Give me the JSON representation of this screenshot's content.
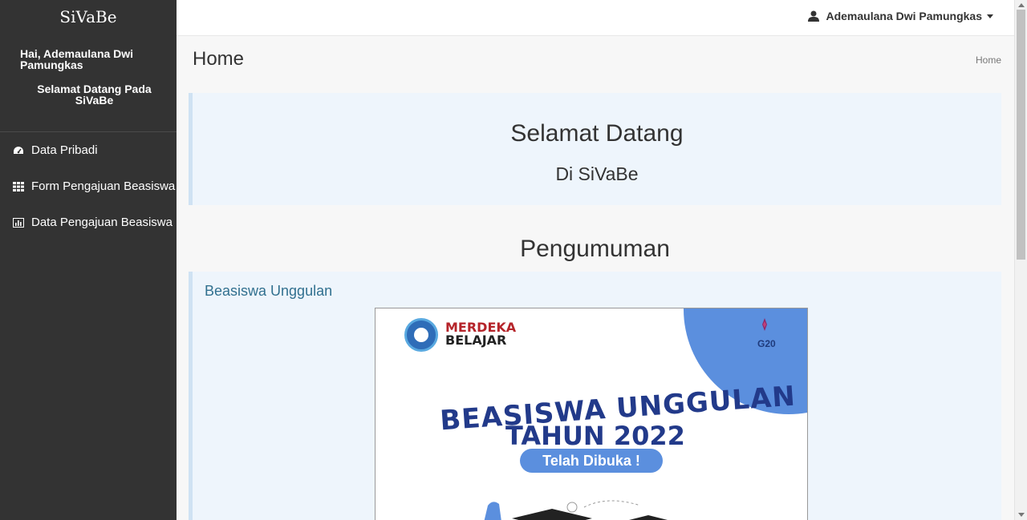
{
  "sidebar": {
    "brand": "SiVaBe",
    "greeting": "Hai, Ademaulana Dwi Pamungkas",
    "welcome": "Selamat Datang Pada SiVaBe",
    "items": [
      {
        "label": "Data Pribadi",
        "icon": "dashboard-icon"
      },
      {
        "label": "Form Pengajuan Beasiswa",
        "icon": "grid-icon"
      },
      {
        "label": "Data Pengajuan Beasiswa",
        "icon": "bar-chart-icon"
      }
    ]
  },
  "topbar": {
    "user_name": "Ademaulana Dwi Pamungkas",
    "user_icon": "user-icon"
  },
  "page": {
    "title": "Home",
    "breadcrumb": "Home"
  },
  "welcome_box": {
    "title": "Selamat Datang",
    "subtitle": "Di SiVaBe"
  },
  "announcements": {
    "heading": "Pengumuman",
    "items": [
      {
        "title": "Beasiswa Unggulan",
        "poster": {
          "logo_top": "MERDEKA",
          "logo_bottom": "BELAJAR",
          "g20": "G20",
          "line1": "BEASISWA UNGGULAN",
          "line2": "TAHUN 2022",
          "badge": "Telah Dibuka !"
        }
      }
    ]
  },
  "colors": {
    "sidebar_bg": "#333333",
    "callout_bg": "#eef5fc",
    "link": "#31708f",
    "poster_blue": "#223a8a",
    "poster_accent": "#5b8fde"
  }
}
